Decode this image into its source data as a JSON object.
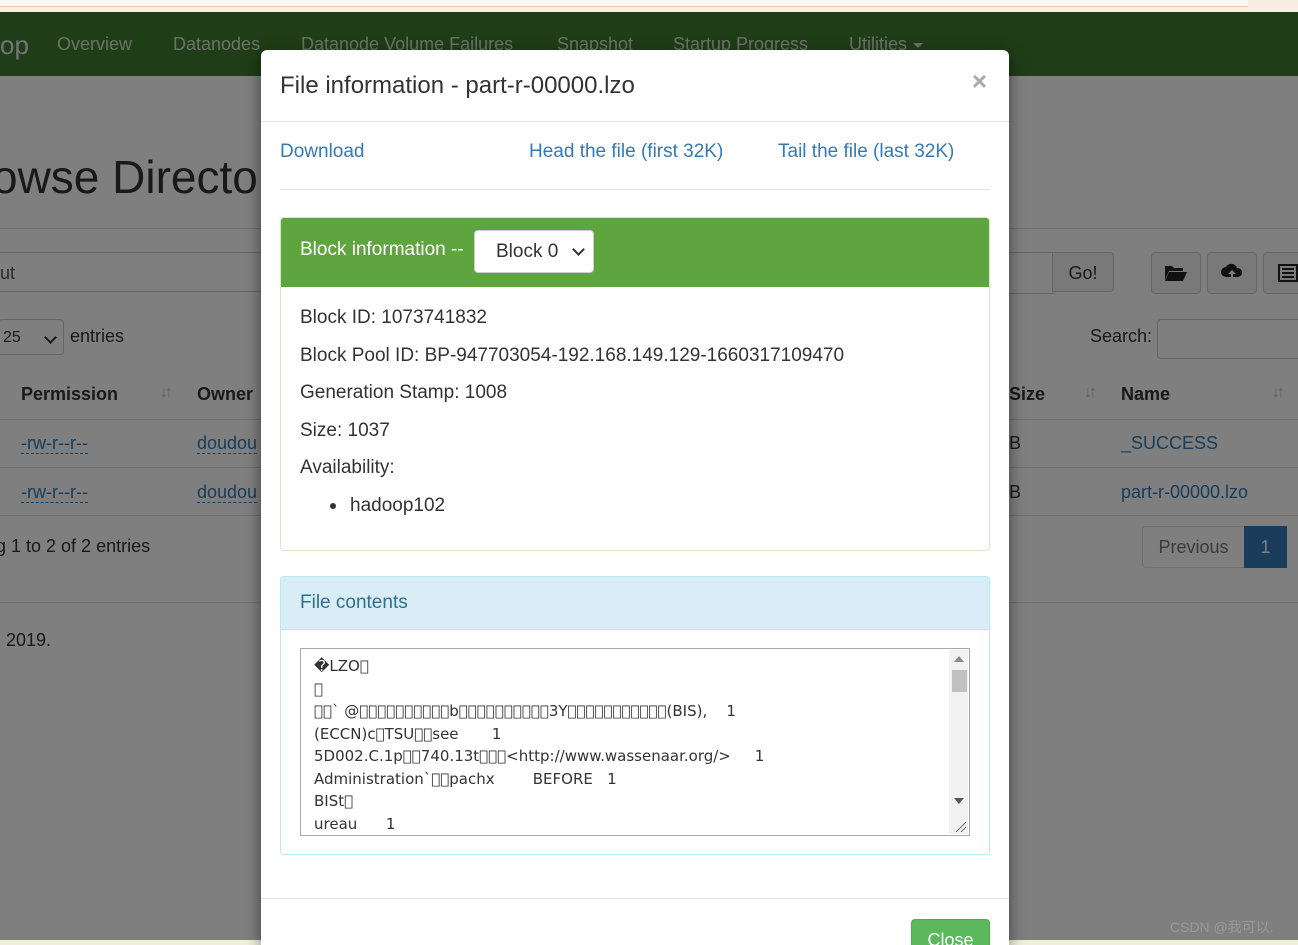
{
  "navbar": {
    "brand": "op",
    "items": [
      "Overview",
      "Datanodes",
      "Datanode Volume Failures",
      "Snapshot",
      "Startup Progress",
      "Utilities"
    ]
  },
  "page": {
    "title": "owse Directo",
    "path_value": "ut",
    "go_label": "Go!",
    "length_value": "25",
    "entries_label": "entries",
    "search_label": "Search:",
    "columns": {
      "permission": "Permission",
      "owner": "Owner",
      "size": "Size",
      "name": "Name"
    },
    "rows": [
      {
        "permission": "-rw-r--r--",
        "owner": "doudou",
        "size": "B",
        "name": "_SUCCESS"
      },
      {
        "permission": "-rw-r--r--",
        "owner": "doudou",
        "size": "B",
        "name": "part-r-00000.lzo"
      }
    ],
    "info": "g 1 to 2 of 2 entries",
    "pager": {
      "previous": "Previous",
      "current": "1"
    },
    "footer": ", 2019."
  },
  "modal": {
    "title": "File information - part-r-00000.lzo",
    "close_x": "×",
    "links": {
      "download": "Download",
      "head": "Head the file (first 32K)",
      "tail": "Tail the file (last 32K)"
    },
    "block_panel": {
      "title": "Block information --",
      "selected_block": "Block 0",
      "block_id": "Block ID: 1073741832",
      "block_pool_id": "Block Pool ID: BP-947703054-192.168.149.129-1660317109470",
      "generation_stamp": "Generation Stamp: 1008",
      "size": "Size: 1037",
      "availability": "Availability:",
      "nodes": [
        "hadoop102"
      ]
    },
    "contents_panel": {
      "title": "File contents",
      "lines": [
        "�LZO\u0000",
        "\u0000",
        "\u0000\u0000` @\u0000\u0000\u0000\u0000\u0000\u0000\u0000\u0000\u0000\u0000b\u0000\u0000\u0000\u0000\u0000\u0000\u0000\u0000\u0000\u00003Y\u0000\u0000\u0000\u0000\u0000\u0000\u0000\u0000\u0000\u0000\u0000(BIS),    1",
        "(ECCN)c\u0000TSU\u0000\u0000see       1",
        "5D002.C.1p\u0000\u0000740.13t\u0000\u0000\u0000<http://www.wassenaar.org/>     1",
        "Administration`\u0000\u0000pachx        BEFORE   1",
        "BISt\u0000",
        "ureau      1"
      ]
    },
    "close_button": "Close"
  },
  "watermark": "CSDN @我可以."
}
